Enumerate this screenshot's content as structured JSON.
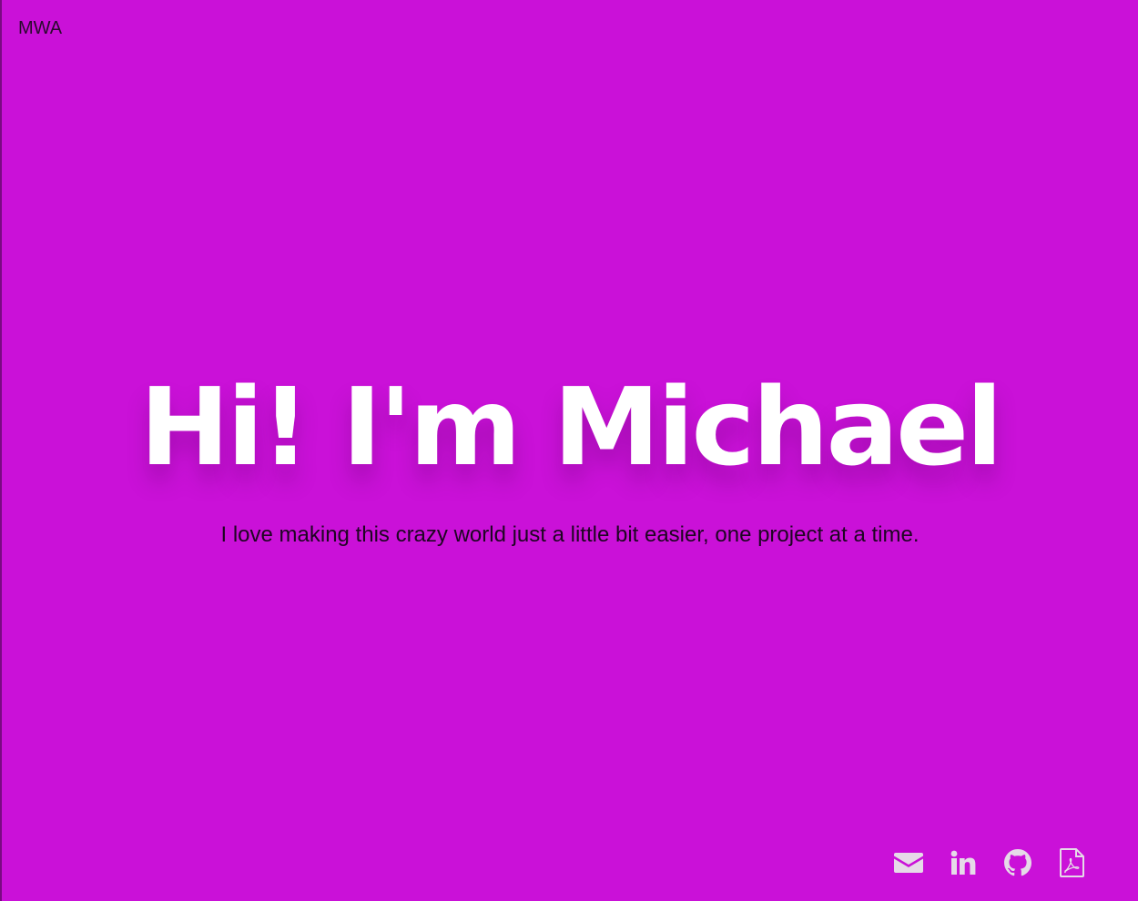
{
  "header": {
    "logo_text": "MWA"
  },
  "hero": {
    "title": "Hi! I'm Michael",
    "subtitle": "I love making this crazy world just a little bit easier, one project at a time."
  },
  "social_links": [
    {
      "icon": "envelope-icon"
    },
    {
      "icon": "linkedin-icon"
    },
    {
      "icon": "github-icon"
    },
    {
      "icon": "pdf-file-icon"
    }
  ],
  "colors": {
    "background": "#ca11d8",
    "title": "#ffffff",
    "subtitle": "#1e0522",
    "icons": "#e6dae8"
  }
}
